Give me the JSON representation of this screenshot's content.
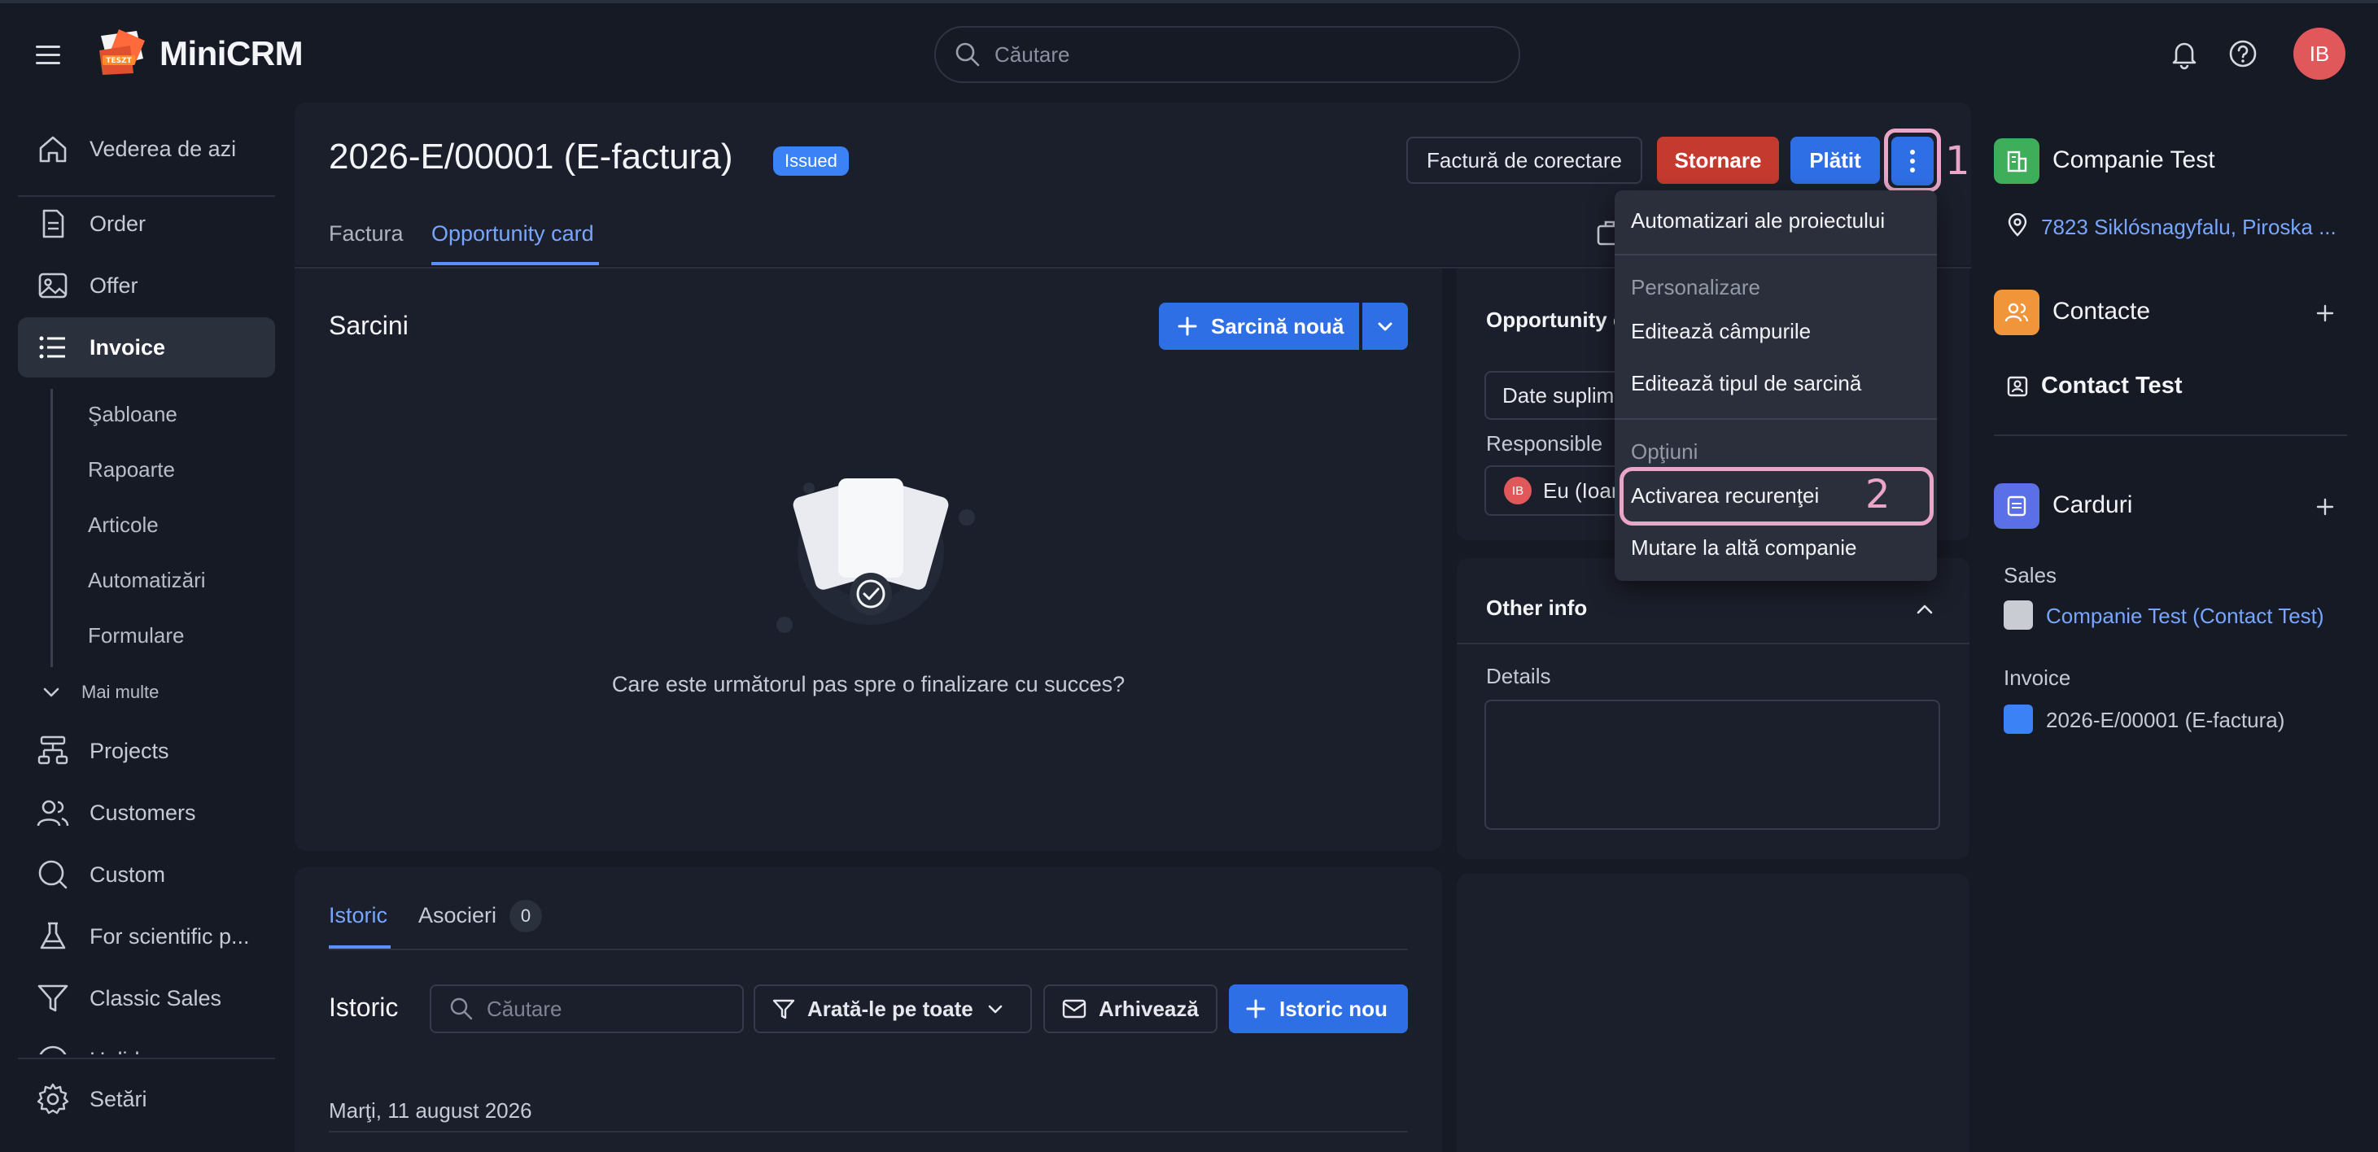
{
  "app": {
    "name": "MiniCRM",
    "logo_badge": "TESZT"
  },
  "top": {
    "search_placeholder": "Căutare",
    "user_initials": "IB"
  },
  "sidebar": {
    "items": [
      {
        "label": "Vederea de azi",
        "icon": "home-icon"
      },
      {
        "label": "Order",
        "icon": "document-icon"
      },
      {
        "label": "Offer",
        "icon": "image-icon"
      },
      {
        "label": "Invoice",
        "icon": "list-icon"
      }
    ],
    "sub_items": [
      "Şabloane",
      "Rapoarte",
      "Articole",
      "Automatizări",
      "Formulare"
    ],
    "more_label": "Mai multe",
    "items2": [
      {
        "label": "Projects",
        "icon": "hierarchy-icon"
      },
      {
        "label": "Customers",
        "icon": "users-icon"
      },
      {
        "label": "Custom",
        "icon": "search-circle-icon"
      },
      {
        "label": "For scientific p...",
        "icon": "flask-icon"
      },
      {
        "label": "Classic Sales",
        "icon": "funnel-icon"
      },
      {
        "label": "Holidays",
        "icon": "umbrella-icon"
      }
    ],
    "settings_label": "Setări"
  },
  "header": {
    "title": "2026-E/00001 (E-factura)",
    "status_badge": "Issued",
    "buttons": {
      "correction": "Factură de corectare",
      "storno": "Stornare",
      "paid": "Plătit"
    },
    "tabs": [
      "Factura",
      "Opportunity card"
    ],
    "active_tab": 1
  },
  "annotations": {
    "first": "1",
    "second": "2"
  },
  "tasks": {
    "title": "Sarcini",
    "new_button": "Sarcină nouă",
    "empty_text": "Care este următorul pas spre o finalizare cu succes?"
  },
  "history": {
    "tabs": [
      "Istoric",
      "Asocieri"
    ],
    "associations_count": "0",
    "title": "Istoric",
    "search_placeholder": "Căutare",
    "filter_label": "Arată-le pe toate",
    "archive_label": "Arhivează",
    "new_button": "Istoric nou",
    "date": "Marţi, 11 august 2026"
  },
  "opportunity": {
    "title": "Opportunity c",
    "date_field": "Date suplim",
    "responsible_label": "Responsible",
    "responsible_value": "Eu (Ioan",
    "responsible_initials": "IB"
  },
  "other_info": {
    "title": "Other info",
    "details_label": "Details"
  },
  "menu": {
    "items_top": [
      "Automatizari ale proiectului"
    ],
    "section_personalizare": "Personalizare",
    "items_personalizare": [
      "Editează câmpurile",
      "Editează tipul de sarcină"
    ],
    "section_optiuni": "Opţiuni",
    "items_optiuni": [
      "Activarea recurenţei",
      "Mutare la altă companie"
    ]
  },
  "right_panel": {
    "company": "Companie Test",
    "address": "7823 Siklósnagyfalu, Piroska ...",
    "contacts_title": "Contacte",
    "contact_name": "Contact Test",
    "cards_title": "Carduri",
    "sales_label": "Sales",
    "sales_link": "Companie Test (Contact Test)",
    "invoice_label": "Invoice",
    "invoice_value": "2026-E/00001 (E-factura)"
  },
  "colors": {
    "background": "#161a24",
    "panel": "#1b1f2b",
    "primary": "#2f6fe6",
    "danger": "#c53a2f",
    "badge": "#3b82f6",
    "annotation": "#e9a6c7",
    "link": "#78a6ff",
    "company_icon": "#3fae5b",
    "contacts_icon": "#f0953a",
    "cards_icon": "#5b6fe6"
  }
}
